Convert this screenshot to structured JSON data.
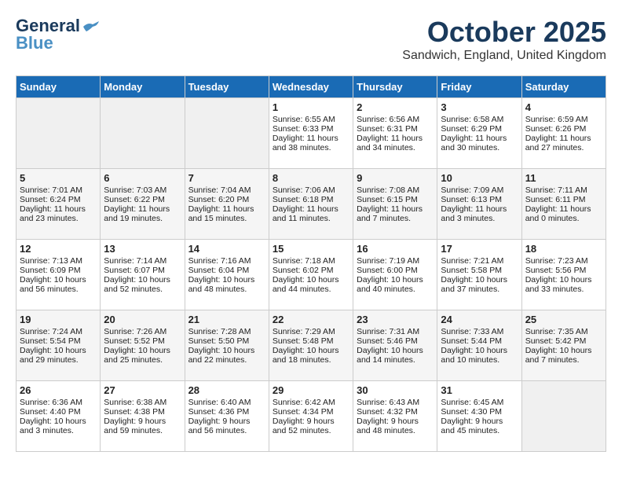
{
  "header": {
    "logo_general": "General",
    "logo_blue": "Blue",
    "month": "October 2025",
    "location": "Sandwich, England, United Kingdom"
  },
  "days_of_week": [
    "Sunday",
    "Monday",
    "Tuesday",
    "Wednesday",
    "Thursday",
    "Friday",
    "Saturday"
  ],
  "weeks": [
    [
      {
        "day": "",
        "sunrise": "",
        "sunset": "",
        "daylight": "",
        "empty": true
      },
      {
        "day": "",
        "sunrise": "",
        "sunset": "",
        "daylight": "",
        "empty": true
      },
      {
        "day": "",
        "sunrise": "",
        "sunset": "",
        "daylight": "",
        "empty": true
      },
      {
        "day": "1",
        "sunrise": "Sunrise: 6:55 AM",
        "sunset": "Sunset: 6:33 PM",
        "daylight": "Daylight: 11 hours and 38 minutes."
      },
      {
        "day": "2",
        "sunrise": "Sunrise: 6:56 AM",
        "sunset": "Sunset: 6:31 PM",
        "daylight": "Daylight: 11 hours and 34 minutes."
      },
      {
        "day": "3",
        "sunrise": "Sunrise: 6:58 AM",
        "sunset": "Sunset: 6:29 PM",
        "daylight": "Daylight: 11 hours and 30 minutes."
      },
      {
        "day": "4",
        "sunrise": "Sunrise: 6:59 AM",
        "sunset": "Sunset: 6:26 PM",
        "daylight": "Daylight: 11 hours and 27 minutes."
      }
    ],
    [
      {
        "day": "5",
        "sunrise": "Sunrise: 7:01 AM",
        "sunset": "Sunset: 6:24 PM",
        "daylight": "Daylight: 11 hours and 23 minutes."
      },
      {
        "day": "6",
        "sunrise": "Sunrise: 7:03 AM",
        "sunset": "Sunset: 6:22 PM",
        "daylight": "Daylight: 11 hours and 19 minutes."
      },
      {
        "day": "7",
        "sunrise": "Sunrise: 7:04 AM",
        "sunset": "Sunset: 6:20 PM",
        "daylight": "Daylight: 11 hours and 15 minutes."
      },
      {
        "day": "8",
        "sunrise": "Sunrise: 7:06 AM",
        "sunset": "Sunset: 6:18 PM",
        "daylight": "Daylight: 11 hours and 11 minutes."
      },
      {
        "day": "9",
        "sunrise": "Sunrise: 7:08 AM",
        "sunset": "Sunset: 6:15 PM",
        "daylight": "Daylight: 11 hours and 7 minutes."
      },
      {
        "day": "10",
        "sunrise": "Sunrise: 7:09 AM",
        "sunset": "Sunset: 6:13 PM",
        "daylight": "Daylight: 11 hours and 3 minutes."
      },
      {
        "day": "11",
        "sunrise": "Sunrise: 7:11 AM",
        "sunset": "Sunset: 6:11 PM",
        "daylight": "Daylight: 11 hours and 0 minutes."
      }
    ],
    [
      {
        "day": "12",
        "sunrise": "Sunrise: 7:13 AM",
        "sunset": "Sunset: 6:09 PM",
        "daylight": "Daylight: 10 hours and 56 minutes."
      },
      {
        "day": "13",
        "sunrise": "Sunrise: 7:14 AM",
        "sunset": "Sunset: 6:07 PM",
        "daylight": "Daylight: 10 hours and 52 minutes."
      },
      {
        "day": "14",
        "sunrise": "Sunrise: 7:16 AM",
        "sunset": "Sunset: 6:04 PM",
        "daylight": "Daylight: 10 hours and 48 minutes."
      },
      {
        "day": "15",
        "sunrise": "Sunrise: 7:18 AM",
        "sunset": "Sunset: 6:02 PM",
        "daylight": "Daylight: 10 hours and 44 minutes."
      },
      {
        "day": "16",
        "sunrise": "Sunrise: 7:19 AM",
        "sunset": "Sunset: 6:00 PM",
        "daylight": "Daylight: 10 hours and 40 minutes."
      },
      {
        "day": "17",
        "sunrise": "Sunrise: 7:21 AM",
        "sunset": "Sunset: 5:58 PM",
        "daylight": "Daylight: 10 hours and 37 minutes."
      },
      {
        "day": "18",
        "sunrise": "Sunrise: 7:23 AM",
        "sunset": "Sunset: 5:56 PM",
        "daylight": "Daylight: 10 hours and 33 minutes."
      }
    ],
    [
      {
        "day": "19",
        "sunrise": "Sunrise: 7:24 AM",
        "sunset": "Sunset: 5:54 PM",
        "daylight": "Daylight: 10 hours and 29 minutes."
      },
      {
        "day": "20",
        "sunrise": "Sunrise: 7:26 AM",
        "sunset": "Sunset: 5:52 PM",
        "daylight": "Daylight: 10 hours and 25 minutes."
      },
      {
        "day": "21",
        "sunrise": "Sunrise: 7:28 AM",
        "sunset": "Sunset: 5:50 PM",
        "daylight": "Daylight: 10 hours and 22 minutes."
      },
      {
        "day": "22",
        "sunrise": "Sunrise: 7:29 AM",
        "sunset": "Sunset: 5:48 PM",
        "daylight": "Daylight: 10 hours and 18 minutes."
      },
      {
        "day": "23",
        "sunrise": "Sunrise: 7:31 AM",
        "sunset": "Sunset: 5:46 PM",
        "daylight": "Daylight: 10 hours and 14 minutes."
      },
      {
        "day": "24",
        "sunrise": "Sunrise: 7:33 AM",
        "sunset": "Sunset: 5:44 PM",
        "daylight": "Daylight: 10 hours and 10 minutes."
      },
      {
        "day": "25",
        "sunrise": "Sunrise: 7:35 AM",
        "sunset": "Sunset: 5:42 PM",
        "daylight": "Daylight: 10 hours and 7 minutes."
      }
    ],
    [
      {
        "day": "26",
        "sunrise": "Sunrise: 6:36 AM",
        "sunset": "Sunset: 4:40 PM",
        "daylight": "Daylight: 10 hours and 3 minutes."
      },
      {
        "day": "27",
        "sunrise": "Sunrise: 6:38 AM",
        "sunset": "Sunset: 4:38 PM",
        "daylight": "Daylight: 9 hours and 59 minutes."
      },
      {
        "day": "28",
        "sunrise": "Sunrise: 6:40 AM",
        "sunset": "Sunset: 4:36 PM",
        "daylight": "Daylight: 9 hours and 56 minutes."
      },
      {
        "day": "29",
        "sunrise": "Sunrise: 6:42 AM",
        "sunset": "Sunset: 4:34 PM",
        "daylight": "Daylight: 9 hours and 52 minutes."
      },
      {
        "day": "30",
        "sunrise": "Sunrise: 6:43 AM",
        "sunset": "Sunset: 4:32 PM",
        "daylight": "Daylight: 9 hours and 48 minutes."
      },
      {
        "day": "31",
        "sunrise": "Sunrise: 6:45 AM",
        "sunset": "Sunset: 4:30 PM",
        "daylight": "Daylight: 9 hours and 45 minutes."
      },
      {
        "day": "",
        "sunrise": "",
        "sunset": "",
        "daylight": "",
        "empty": true
      }
    ]
  ]
}
